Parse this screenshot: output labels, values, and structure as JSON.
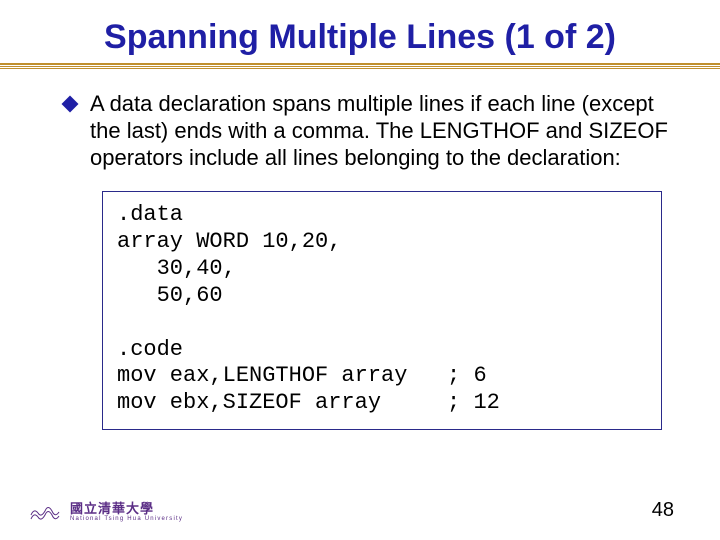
{
  "title": "Spanning Multiple Lines (1 of 2)",
  "bullet": "A data declaration spans multiple lines if each line (except the last) ends with a comma. The LENGTHOF and SIZEOF operators include all lines belonging to the declaration:",
  "code": ".data\narray WORD 10,20,\n   30,40,\n   50,60\n\n.code\nmov eax,LENGTHOF array   ; 6\nmov ebx,SIZEOF array     ; 12",
  "footer": {
    "cn": "國立清華大學",
    "en": "National Tsing Hua University"
  },
  "page": "48"
}
